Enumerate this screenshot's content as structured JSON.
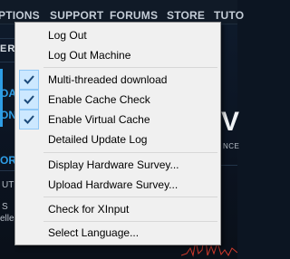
{
  "background": {
    "nav": [
      "PTIONS",
      "SUPPORT",
      "FORUMS",
      "STORE",
      "TUTO"
    ],
    "fragments": {
      "ery": "ERY",
      "oad1": "OAD",
      "oad2": "AD",
      "oad3": "ON",
      "or": "OR",
      "ut": "UT",
      "s": "S",
      "elle": "elle",
      "big": "V",
      "nce": "NCE"
    }
  },
  "menu": {
    "items": [
      {
        "label": "Log Out",
        "checked": false
      },
      {
        "label": "Log Out Machine",
        "checked": false
      },
      {
        "label": "Multi-threaded download",
        "checked": true
      },
      {
        "label": "Enable Cache Check",
        "checked": true
      },
      {
        "label": "Enable Virtual Cache",
        "checked": true
      },
      {
        "label": "Detailed Update Log",
        "checked": false
      },
      {
        "label": "Display Hardware Survey...",
        "checked": false
      },
      {
        "label": "Upload Hardware Survey...",
        "checked": false
      },
      {
        "label": "Check for XInput",
        "checked": false
      },
      {
        "label": "Select Language...",
        "checked": false
      }
    ]
  },
  "colors": {
    "menu_bg": "#f0f0f0",
    "check_bg": "#cce8ff",
    "check_border": "#90c8f6",
    "check_mark": "#1c4a7a",
    "accent_blue": "#2e9ee6",
    "graph_red": "#d33a2c"
  },
  "icons": {
    "check": "checkmark-icon"
  }
}
